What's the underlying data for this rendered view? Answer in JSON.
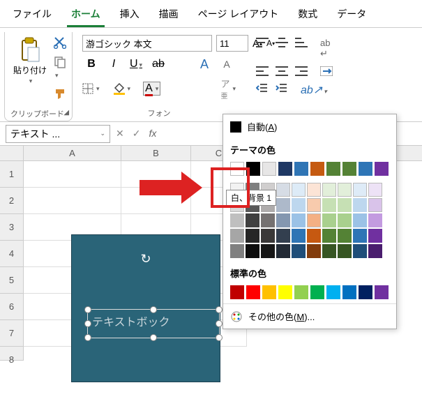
{
  "tabs": {
    "file": "ファイル",
    "home": "ホーム",
    "insert": "挿入",
    "draw": "描画",
    "page_layout": "ページ レイアウト",
    "formulas": "数式",
    "data": "データ"
  },
  "clipboard": {
    "paste": "貼り付け",
    "group_label": "クリップボード"
  },
  "font": {
    "font_name": "游ゴシック 本文",
    "font_size": "11",
    "bold": "B",
    "italic": "I",
    "underline": "U",
    "font_letter": "A",
    "group_label": "フォン"
  },
  "name_box": {
    "value": "テキスト ..."
  },
  "formula_bar": {
    "fx": "fx"
  },
  "columns": [
    "A",
    "B",
    "C"
  ],
  "rows": [
    "1",
    "2",
    "3",
    "4",
    "5",
    "6",
    "7",
    "8"
  ],
  "shape": {
    "placeholder": "テキストボック"
  },
  "color_menu": {
    "auto": "自動(A)",
    "auto_accel": "A",
    "theme_label": "テーマの色",
    "standard_label": "標準の色",
    "more": "その他の色(M)...",
    "more_accel": "M",
    "tooltip": "白、背景 1",
    "theme_top": [
      "#ffffff",
      "#000000",
      "#e7e6e6",
      "#1f3864",
      "#2f75b5",
      "#c55a11",
      "#548235",
      "#548235",
      "#2e75b6",
      "#7030a0"
    ],
    "theme_variants": [
      [
        "#f2f2f2",
        "#7f7f7f",
        "#d0cece",
        "#d6dce5",
        "#ddebf7",
        "#fce4d6",
        "#e2efda",
        "#e2efda",
        "#deebf7",
        "#ede2f6"
      ],
      [
        "#d9d9d9",
        "#595959",
        "#aeabab",
        "#adb9ca",
        "#bdd7ee",
        "#f8cbad",
        "#c6e0b4",
        "#c6e0b4",
        "#bdd7ee",
        "#d9c3ea"
      ],
      [
        "#bfbfbf",
        "#404040",
        "#757171",
        "#8497b0",
        "#9bc2e6",
        "#f4b084",
        "#a9d08e",
        "#a9d08e",
        "#9bc2e6",
        "#c39be0"
      ],
      [
        "#a6a6a6",
        "#262626",
        "#3a3838",
        "#333f4f",
        "#2f75b5",
        "#c65911",
        "#548235",
        "#548235",
        "#2e75b6",
        "#7030a0"
      ],
      [
        "#808080",
        "#0d0d0d",
        "#161616",
        "#222a35",
        "#1f4e79",
        "#833c0c",
        "#375623",
        "#375623",
        "#1f4e79",
        "#4a1d6e"
      ]
    ],
    "standard": [
      "#c00000",
      "#ff0000",
      "#ffc000",
      "#ffff00",
      "#92d050",
      "#00b050",
      "#00b0f0",
      "#0070c0",
      "#002060",
      "#7030a0"
    ]
  }
}
